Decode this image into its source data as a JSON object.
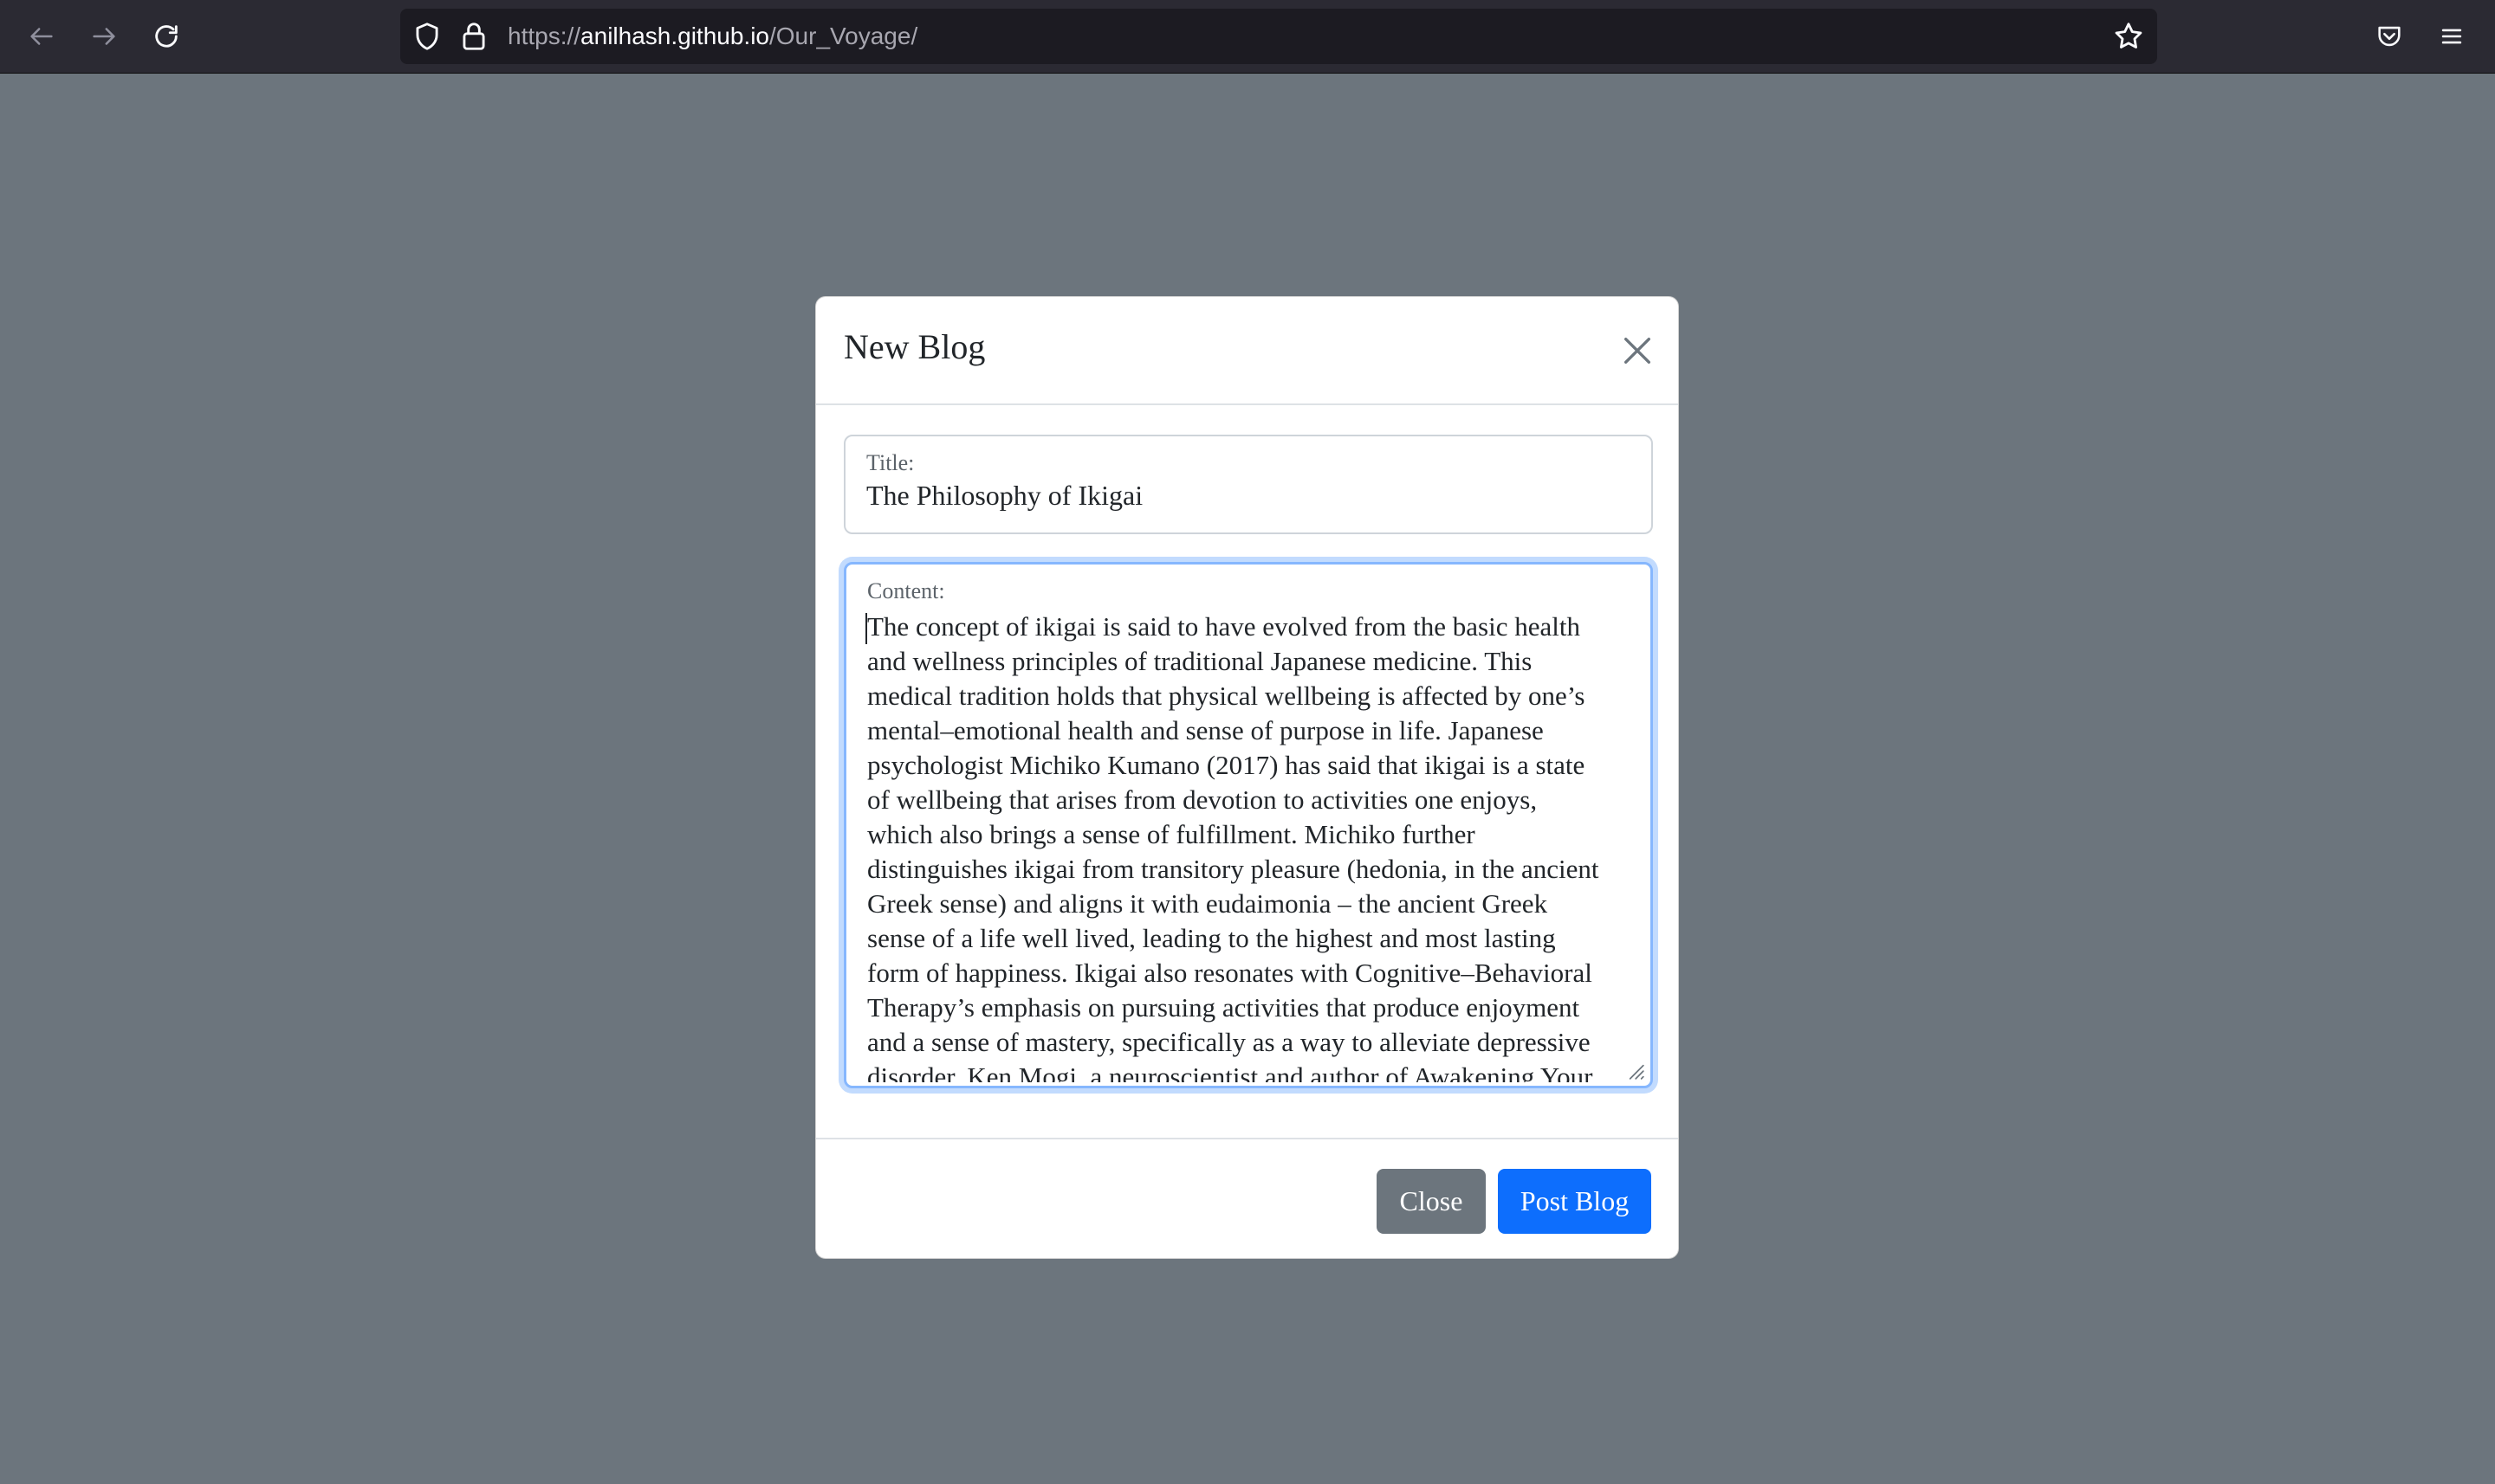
{
  "browser": {
    "url_scheme": "https://",
    "url_host": "anilhash.github.io",
    "url_path": "/Our_Voyage/",
    "back_icon": "arrow-left-icon",
    "forward_icon": "arrow-right-icon",
    "reload_icon": "reload-icon",
    "shield_icon": "shield-icon",
    "lock_icon": "lock-icon",
    "bookmark_icon": "star-icon",
    "pocket_icon": "pocket-icon",
    "menu_icon": "hamburger-menu-icon"
  },
  "modal": {
    "title": "New Blog",
    "close_icon": "close-icon",
    "title_field": {
      "label": "Title:",
      "value": "The Philosophy of Ikigai"
    },
    "content_field": {
      "label": "Content:",
      "lines": [
        "The concept of ikigai is said to have evolved from the basic health",
        "and wellness principles of traditional Japanese medicine. This",
        "medical tradition holds that physical wellbeing is affected by one’s",
        "mental–emotional health and sense of purpose in life. Japanese",
        "psychologist Michiko Kumano (2017) has said that ikigai is a state",
        "of wellbeing that arises from devotion to activities one enjoys,",
        "which also brings a sense of fulfillment. Michiko further",
        "distinguishes ikigai from transitory pleasure (hedonia, in the ancient",
        "Greek sense) and aligns it with eudaimonia – the ancient Greek",
        "sense of a life well lived, leading to the highest and most lasting",
        "form of happiness. Ikigai also resonates with Cognitive–Behavioral",
        "Therapy’s emphasis on pursuing activities that produce enjoyment",
        "and a sense of mastery, specifically as a way to alleviate depressive",
        "disorder. Ken Mogi, a neuroscientist and author of Awakening Your"
      ]
    },
    "buttons": {
      "close_label": "Close",
      "post_label": "Post Blog"
    }
  },
  "colors": {
    "backdrop": "#6c757d",
    "primary": "#0d6efd",
    "secondary": "#6c757d"
  }
}
